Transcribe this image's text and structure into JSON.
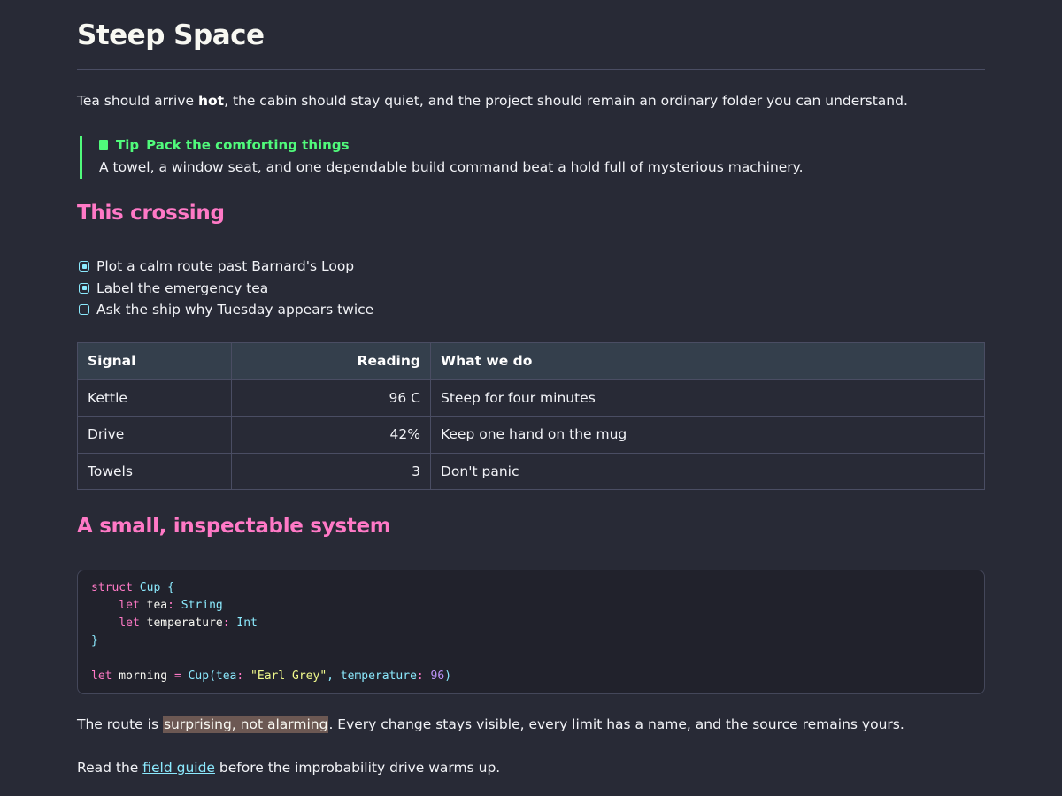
{
  "title": "Steep Space",
  "intro": {
    "before": "Tea should arrive ",
    "bold": "hot",
    "after": ", the cabin should stay quiet, and the project should remain an ordinary folder you can understand."
  },
  "tip": {
    "label": "Tip",
    "title": "Pack the comforting things",
    "body": "A towel, a window seat, and one dependable build command beat a hold full of mysterious machinery.",
    "color": "#50fa7b",
    "icon": "bookmark-icon"
  },
  "section1": {
    "heading": "This crossing"
  },
  "tasks": [
    {
      "label": "Plot a calm route past Barnard's Loop",
      "checked": true
    },
    {
      "label": "Label the emergency tea",
      "checked": true
    },
    {
      "label": "Ask the ship why Tuesday appears twice",
      "checked": false
    }
  ],
  "table": {
    "headers": [
      "Signal",
      "Reading",
      "What we do"
    ],
    "rows": [
      [
        "Kettle",
        "96 C",
        "Steep for four minutes"
      ],
      [
        "Drive",
        "42%",
        "Keep one hand on the mug"
      ],
      [
        "Towels",
        "3",
        "Don't panic"
      ]
    ]
  },
  "section2": {
    "heading": "A small, inspectable system"
  },
  "code": {
    "line1": [
      "struct",
      " ",
      "Cup",
      " {"
    ],
    "line2": [
      "    ",
      "let",
      " tea",
      ": ",
      "String"
    ],
    "line3": [
      "    ",
      "let",
      " temperature",
      ": ",
      "Int"
    ],
    "line4": [
      "}"
    ],
    "line6": [
      "let",
      " morning ",
      "=",
      " ",
      "Cup",
      "(",
      "tea",
      ": ",
      "\"Earl Grey\"",
      ", ",
      "temperature",
      ": ",
      "96",
      ")"
    ]
  },
  "para1": {
    "before": "The route is ",
    "highlight": "surprising, not alarming",
    "after": ". Every change stays visible, every limit has a name, and the source remains yours."
  },
  "para2": {
    "before": "Read the ",
    "link": "field guide",
    "after": " before the improbability drive warms up."
  },
  "colors": {
    "background": "#282a36",
    "heading": "#ff79c6",
    "accent": "#8be9fd",
    "tip": "#50fa7b",
    "highlight": "#6c5853"
  }
}
